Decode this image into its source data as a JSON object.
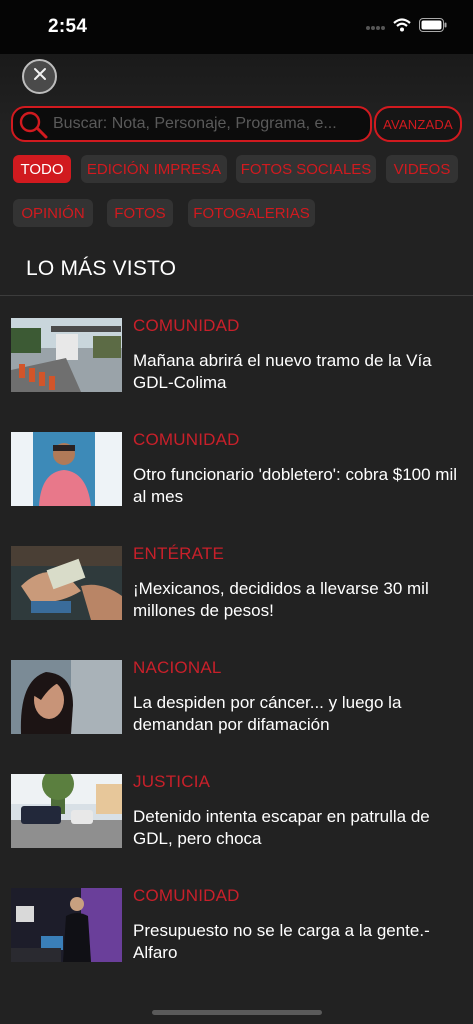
{
  "status_bar": {
    "time": "2:54"
  },
  "search": {
    "placeholder": "Buscar: Nota, Personaje, Programa, e...",
    "advanced_label": "AVANZADA"
  },
  "filters": [
    "TODO",
    "EDICIÓN IMPRESA",
    "FOTOS SOCIALES",
    "VIDEOS",
    "OPINIÓN",
    "FOTOS",
    "FOTOGALERIAS"
  ],
  "active_filter": "TODO",
  "section_title": "LO MÁS VISTO",
  "articles": [
    {
      "category": "COMUNIDAD",
      "headline": "Mañana abrirá el nuevo tramo de la Vía GDL-Colima"
    },
    {
      "category": "COMUNIDAD",
      "headline": "Otro funcionario 'dobletero': cobra $100 mil al mes"
    },
    {
      "category": "ENTÉRATE",
      "headline": "¡Mexicanos, decididos a llevarse 30 mil millones de pesos!"
    },
    {
      "category": "NACIONAL",
      "headline": "La despiden por cáncer... y luego la demandan por difamación"
    },
    {
      "category": "JUSTICIA",
      "headline": "Detenido intenta escapar en patrulla de GDL, pero choca"
    },
    {
      "category": "COMUNIDAD",
      "headline": "Presupuesto no se le carga a la gente.- Alfaro"
    }
  ],
  "colors": {
    "accent": "#d11a1f",
    "background": "#222222",
    "chip": "#333333"
  },
  "icons": [
    "close-icon",
    "search-icon",
    "wifi-icon",
    "signal-icon",
    "battery-icon"
  ]
}
